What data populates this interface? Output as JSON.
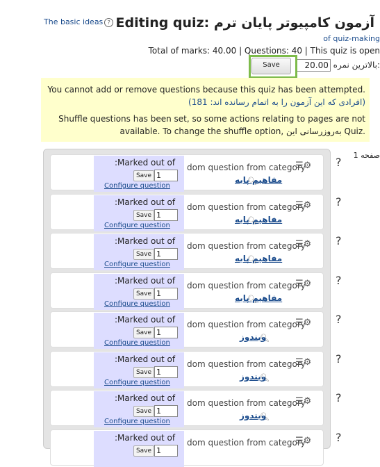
{
  "header": {
    "help_link_text": "The basic ideas",
    "title": "Editing quiz: آزمون کامپیوتر پایان ترم",
    "help_link_text2": "of quiz-making",
    "marks_summary": "Total of marks: 40.00 | Questions: 40 | This quiz is open",
    "max_grade_label": "بالاترین نمره:",
    "max_grade_value": "20.00",
    "save_label": "Save"
  },
  "notice": {
    "line1": "You cannot add or remove questions because this quiz has been attempted.",
    "line2": "(افرادی که این آزمون را به اتمام رسانده اند: 181)",
    "line3": "Shuffle questions has been set, so some actions relating to pages are not",
    "line4": "available. To change the shuffle option, به‌روزرسانی این Quiz."
  },
  "page_label": "صفحه 1",
  "slots": [
    {
      "marked_label": ":Marked out of",
      "save": "Save",
      "mark": "1",
      "configure": "Configure question",
      "random_text": "dom question from category",
      "category": "مفاهیم پایه",
      "qmark": "?"
    },
    {
      "marked_label": ":Marked out of",
      "save": "Save",
      "mark": "1",
      "configure": "Configure question",
      "random_text": "dom question from category",
      "category": "مفاهیم پایه",
      "qmark": "?"
    },
    {
      "marked_label": ":Marked out of",
      "save": "Save",
      "mark": "1",
      "configure": "Configure question",
      "random_text": "dom question from category",
      "category": "مفاهیم پایه",
      "qmark": "?"
    },
    {
      "marked_label": ":Marked out of",
      "save": "Save",
      "mark": "1",
      "configure": "Configure question",
      "random_text": "dom question from category",
      "category": "مفاهیم پایه",
      "qmark": "?"
    },
    {
      "marked_label": ":Marked out of",
      "save": "Save",
      "mark": "1",
      "configure": "Configure question",
      "random_text": "dom question from category",
      "category": "ویندوز",
      "qmark": "?"
    },
    {
      "marked_label": ":Marked out of",
      "save": "Save",
      "mark": "1",
      "configure": "Configure question",
      "random_text": "dom question from category",
      "category": "ویندوز",
      "qmark": "?"
    },
    {
      "marked_label": ":Marked out of",
      "save": "Save",
      "mark": "1",
      "configure": "Configure question",
      "random_text": "dom question from category",
      "category": "ویندوز",
      "qmark": "?"
    },
    {
      "marked_label": ":Marked out of",
      "save": "Save",
      "mark": "1",
      "configure": "",
      "random_text": "dom question from category",
      "category": "",
      "qmark": "?"
    }
  ]
}
